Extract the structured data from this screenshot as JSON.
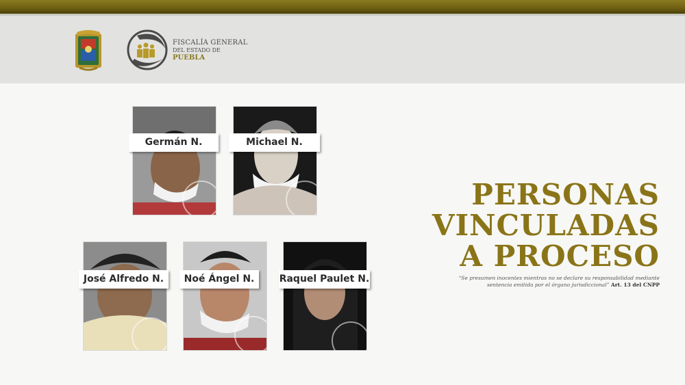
{
  "header": {
    "org_line1": "FISCALÍA GENERAL",
    "org_line2": "DEL ESTADO DE",
    "org_line3": "PUEBLA"
  },
  "persons": [
    {
      "name": "Germán N."
    },
    {
      "name": "Michael N."
    },
    {
      "name": "José Alfredo N."
    },
    {
      "name": "Noé Ángel N."
    },
    {
      "name": "Raquel Paulet N."
    }
  ],
  "title": {
    "line1": "PERSONAS",
    "line2": "VINCULADAS",
    "line3": "A PROCESO"
  },
  "disclaimer": {
    "quote_line1": "“Se presumen inocentes mientras no se declare su responsabilidad mediante",
    "quote_line2": "sentencia emitida por el órgano jurisdiccional”",
    "citation": "Art. 13 del CNPP"
  },
  "colors": {
    "gold": "#8a7418",
    "header_bg": "#e2e2e0",
    "top_bar": "#6d5f12"
  }
}
